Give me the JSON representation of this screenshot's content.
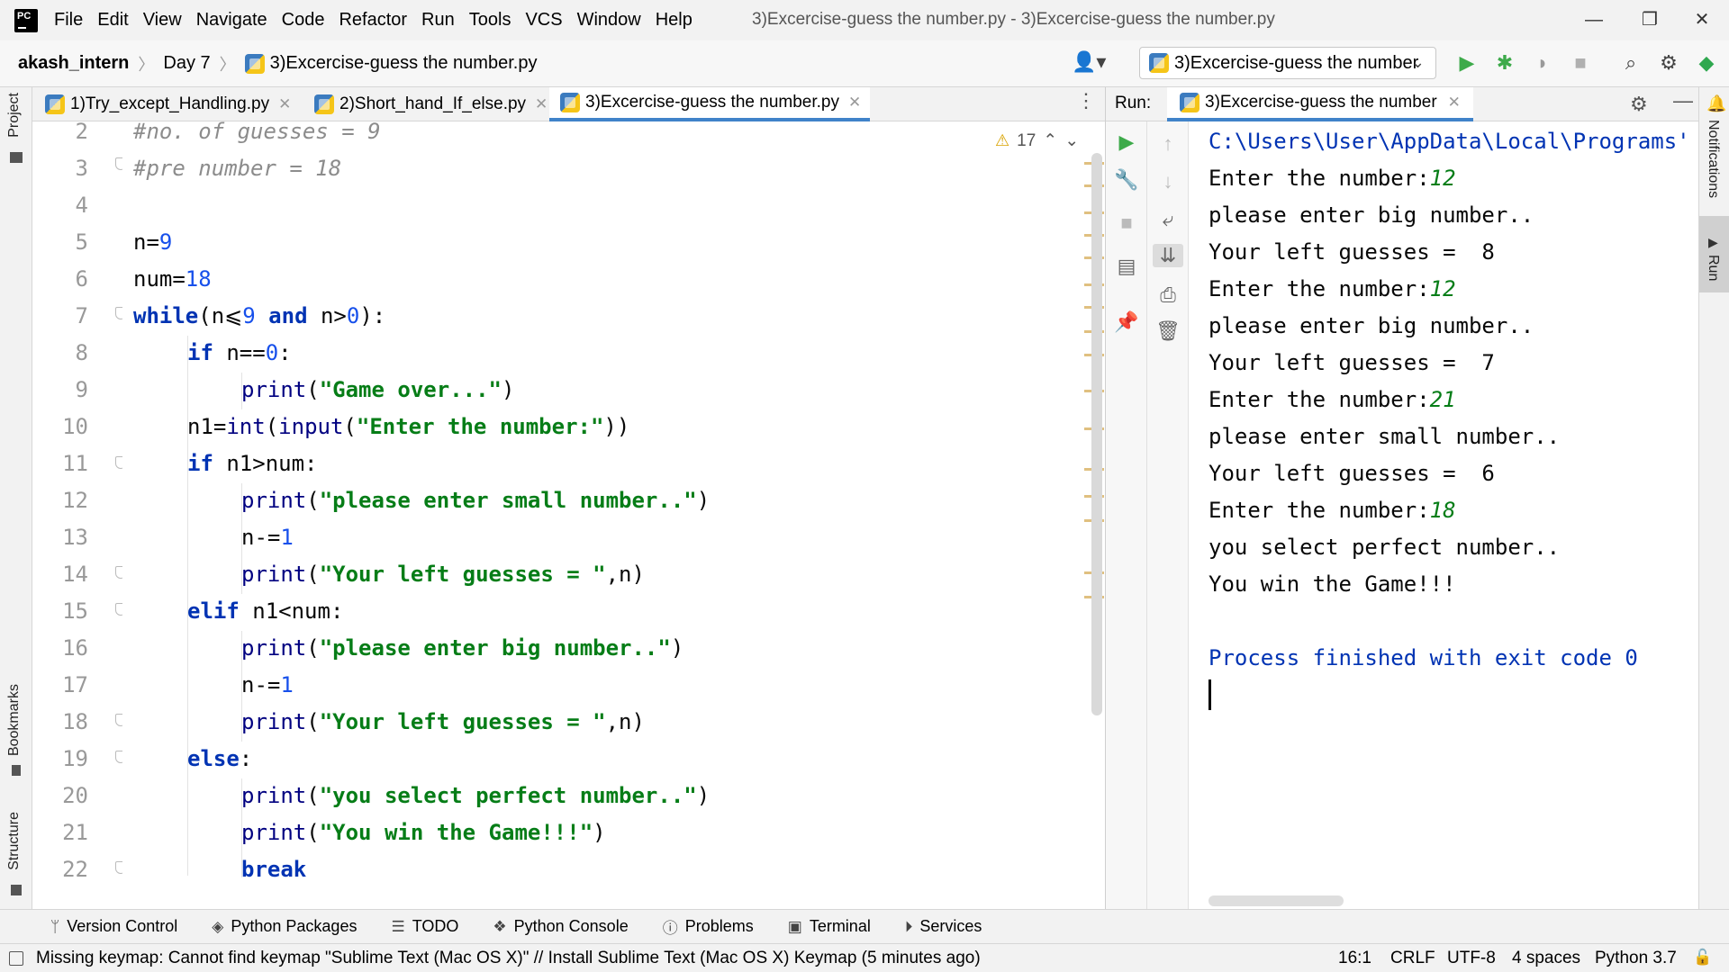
{
  "app": {
    "logo_text": "PC",
    "window_title": "3)Excercise-guess the number.py - 3)Excercise-guess the number.py"
  },
  "menu": [
    "File",
    "Edit",
    "View",
    "Navigate",
    "Code",
    "Refactor",
    "Run",
    "Tools",
    "VCS",
    "Window",
    "Help"
  ],
  "window_controls": {
    "minimize": "—",
    "restore": "❐",
    "close": "✕"
  },
  "breadcrumb": {
    "project": "akash_intern",
    "folder": "Day 7",
    "file": "3)Excercise-guess the number.py"
  },
  "run_config": {
    "label": "3)Excercise-guess the number"
  },
  "editor_tabs": [
    {
      "label": "1)Try_except_Handling.py"
    },
    {
      "label": "2)Short_hand_If_else.py"
    },
    {
      "label": "3)Excercise-guess the number.py"
    }
  ],
  "inspection": {
    "warnings": "17"
  },
  "code_lines": [
    {
      "num": "2",
      "text": "#no. of guesses = 9"
    },
    {
      "num": "3",
      "text": "#pre number = 18"
    },
    {
      "num": "4",
      "text": ""
    },
    {
      "num": "5",
      "text": "n=9"
    },
    {
      "num": "6",
      "text": "num=18"
    },
    {
      "num": "7",
      "text": "while(n⩽9 and n>0):"
    },
    {
      "num": "8",
      "text": "if n==0:"
    },
    {
      "num": "9",
      "text": "print(\"Game over...\")"
    },
    {
      "num": "10",
      "text": "n1=int(input(\"Enter the number:\"))"
    },
    {
      "num": "11",
      "text": "if n1>num:"
    },
    {
      "num": "12",
      "text": "print(\"please enter small number..\")"
    },
    {
      "num": "13",
      "text": "n-=1"
    },
    {
      "num": "14",
      "text": "print(\"Your left guesses = \",n)"
    },
    {
      "num": "15",
      "text": "elif n1<num:"
    },
    {
      "num": "16",
      "text": "print(\"please enter big number..\")"
    },
    {
      "num": "17",
      "text": "n-=1"
    },
    {
      "num": "18",
      "text": "print(\"Your left guesses = \",n)"
    },
    {
      "num": "19",
      "text": "else:"
    },
    {
      "num": "20",
      "text": "print(\"you select perfect number..\")"
    },
    {
      "num": "21",
      "text": "print(\"You win the Game!!!\")"
    },
    {
      "num": "22",
      "text": "break"
    }
  ],
  "run_panel": {
    "label": "Run:",
    "tab": "3)Excercise-guess the number",
    "console": {
      "path": "C:\\Users\\User\\AppData\\Local\\Programs'",
      "prompt": "Enter the number:",
      "lines": [
        {
          "prompt": true,
          "input": "12"
        },
        {
          "text": "please enter big number.."
        },
        {
          "text": "Your left guesses =  8"
        },
        {
          "prompt": true,
          "input": "12"
        },
        {
          "text": "please enter big number.."
        },
        {
          "text": "Your left guesses =  7"
        },
        {
          "prompt": true,
          "input": "21"
        },
        {
          "text": "please enter small number.."
        },
        {
          "text": "Your left guesses =  6"
        },
        {
          "prompt": true,
          "input": "18"
        },
        {
          "text": "you select perfect number.."
        },
        {
          "text": "You win the Game!!!"
        }
      ],
      "exit": "Process finished with exit code 0"
    }
  },
  "left_tabs": {
    "project": "Project",
    "bookmarks": "Bookmarks",
    "structure": "Structure"
  },
  "right_tabs": {
    "notifications": "Notifications",
    "run": "Run"
  },
  "bottom_tools": [
    {
      "label": "Version Control",
      "icon": "branch-icon"
    },
    {
      "label": "Python Packages",
      "icon": "layers-icon"
    },
    {
      "label": "TODO",
      "icon": "list-icon"
    },
    {
      "label": "Python Console",
      "icon": "python-icon"
    },
    {
      "label": "Problems",
      "icon": "info-icon"
    },
    {
      "label": "Terminal",
      "icon": "terminal-icon"
    },
    {
      "label": "Services",
      "icon": "services-icon"
    }
  ],
  "status": {
    "message": "Missing keymap: Cannot find keymap \"Sublime Text (Mac OS X)\" // Install Sublime Text (Mac OS X) Keymap (5 minutes ago)",
    "position": "16:1",
    "line_ending": "CRLF",
    "encoding": "UTF-8",
    "indent": "4 spaces",
    "interpreter": "Python 3.7"
  },
  "colors": {
    "accent": "#4083c9",
    "keyword": "#0033b3",
    "string": "#067d17",
    "number": "#1750eb",
    "comment": "#8c8c8c"
  }
}
